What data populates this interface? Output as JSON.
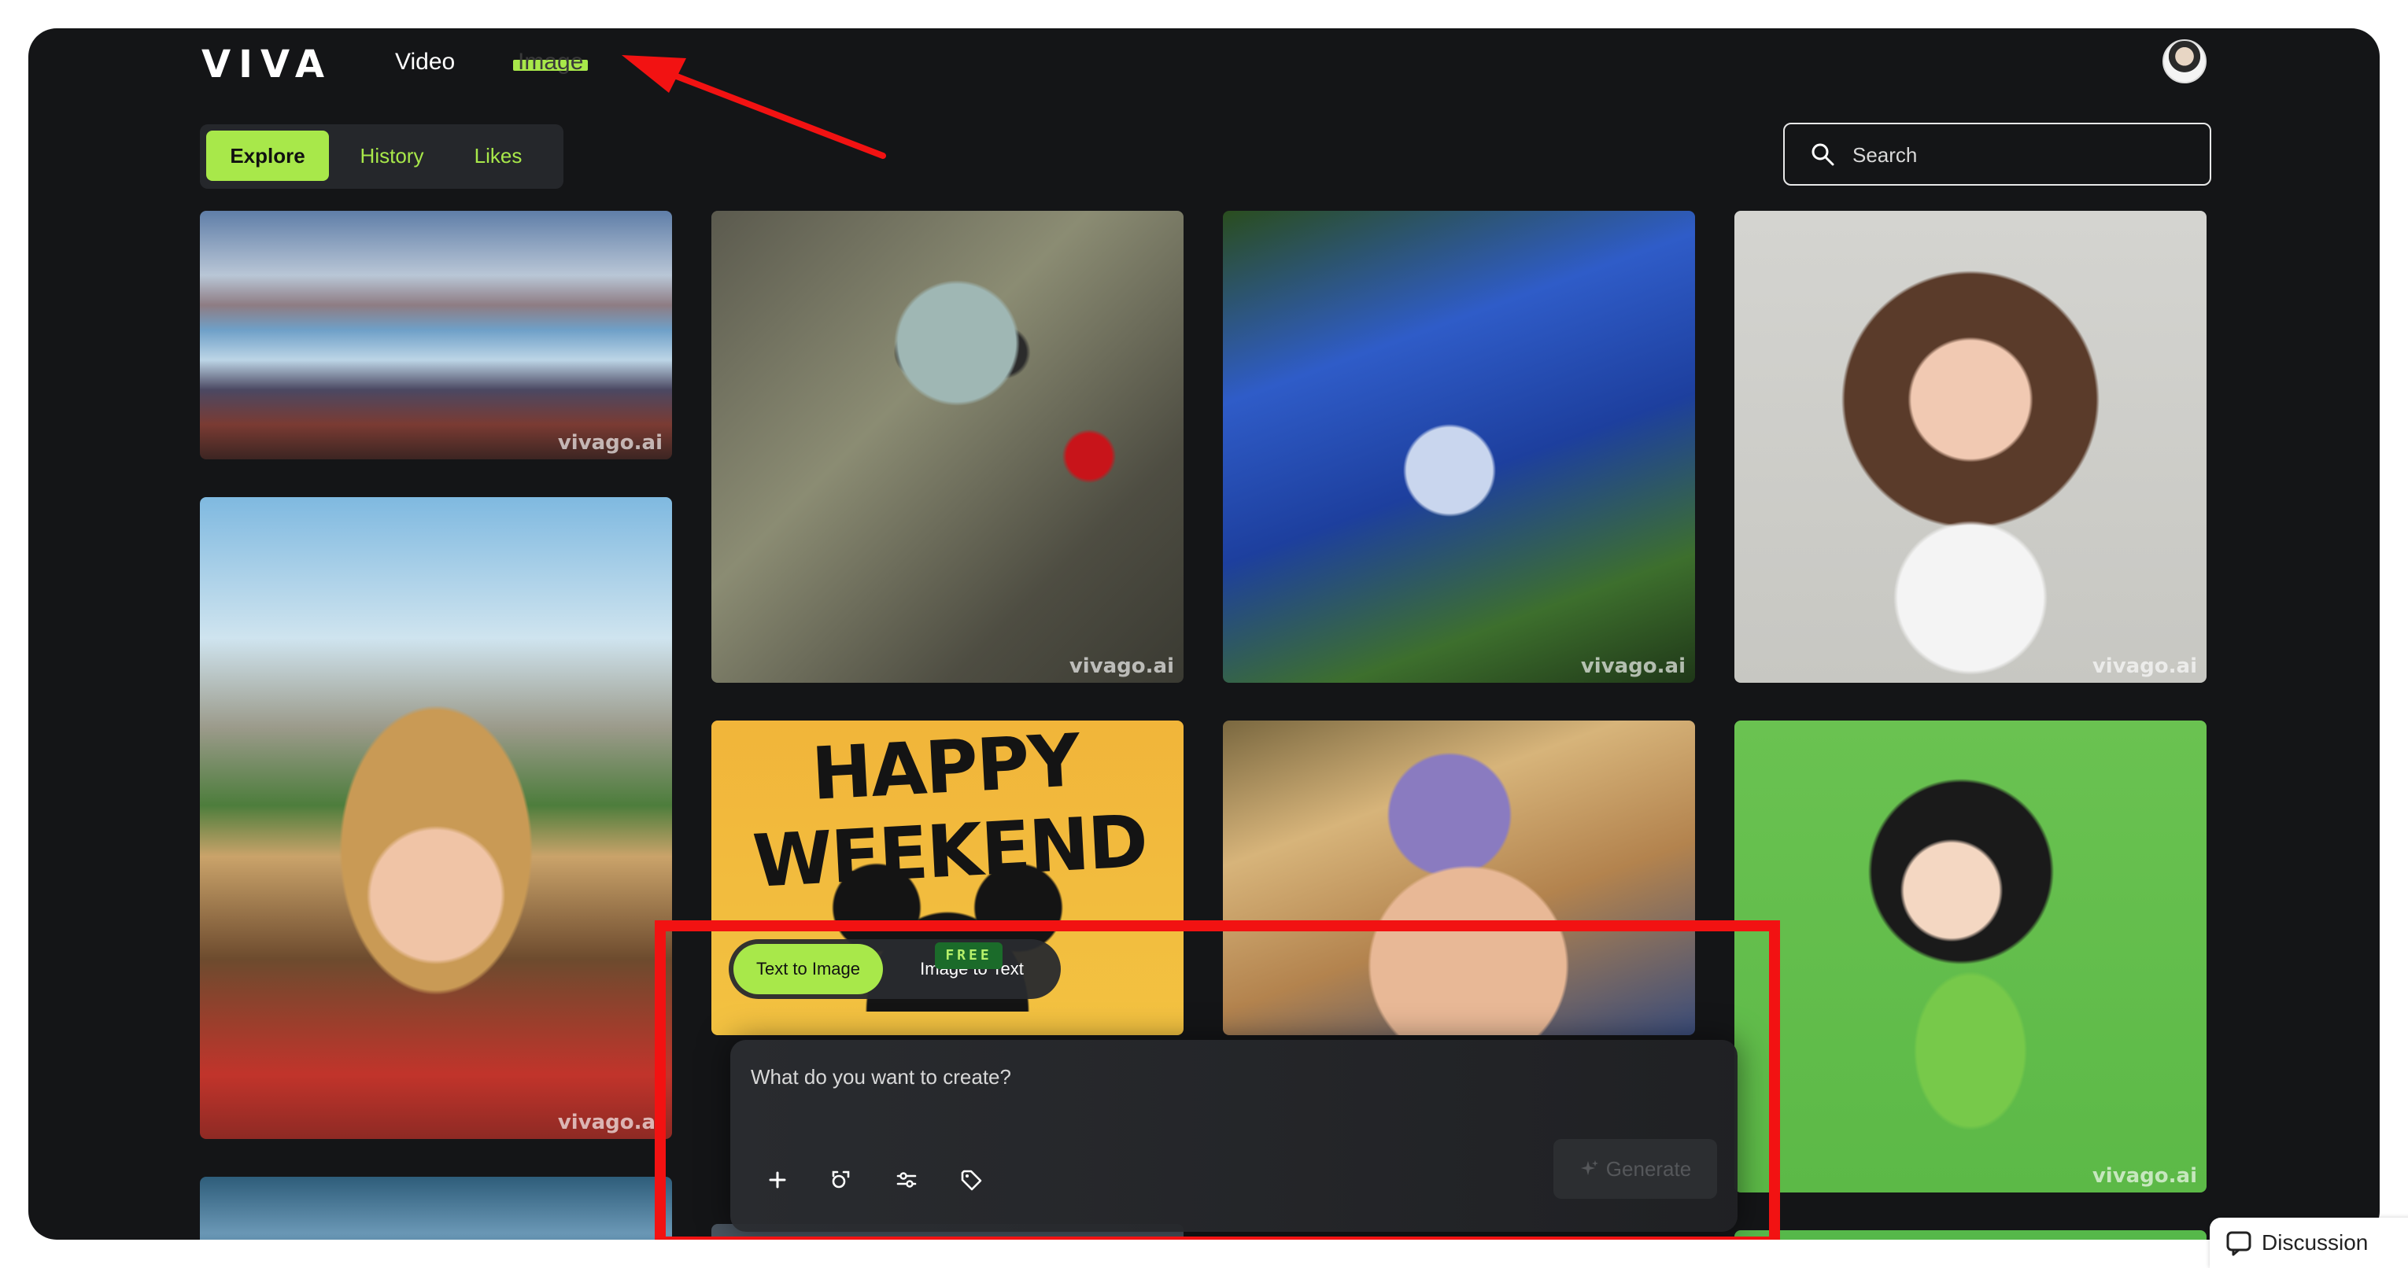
{
  "brand": {
    "logo_text": "VIVA"
  },
  "nav": {
    "video_label": "Video",
    "image_label": "Image"
  },
  "tabs": {
    "explore_label": "Explore",
    "history_label": "History",
    "likes_label": "Likes"
  },
  "search": {
    "placeholder": "Search"
  },
  "gallery": {
    "watermark": "vivago.ai",
    "weekend_headline": "HAPPY WEEKEND"
  },
  "creator": {
    "mode_text_to_image": "Text to Image",
    "mode_image_to_text": "Image to Text",
    "free_badge": "FREE",
    "prompt_placeholder": "What do you want to create?",
    "generate_label": "Generate"
  },
  "footer": {
    "discussion_label": "Discussion"
  },
  "colors": {
    "accent": "#a8e84a",
    "background": "#141517",
    "annotation_red": "#f21212"
  },
  "icons": [
    "search-icon",
    "plus-icon",
    "image-reference-icon",
    "sliders-icon",
    "tag-icon",
    "sparkle-icon",
    "chat-icon"
  ]
}
